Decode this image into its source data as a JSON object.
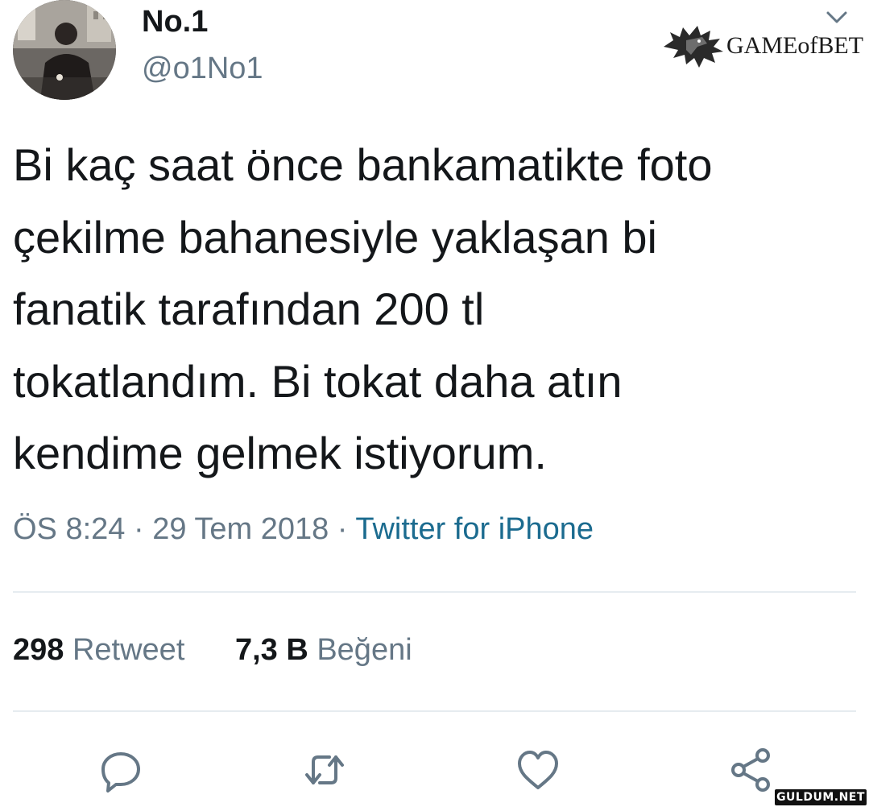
{
  "author": {
    "name": "No.1",
    "handle": "@o1No1"
  },
  "watermark": {
    "brand_text": "GAMEofBET"
  },
  "tweet": {
    "lines": [
      "Bi kaç saat önce bankamatikte foto",
      "çekilme bahanesiyle yaklaşan bi",
      "fanatik tarafından 200 tl",
      "tokatlandım. Bi tokat daha atın",
      "kendime gelmek istiyorum."
    ]
  },
  "meta": {
    "time": "ÖS 8:24",
    "separator": " · ",
    "date": "29 Tem 2018",
    "source": "Twitter for iPhone"
  },
  "stats": {
    "retweet_count": "298",
    "retweet_label": "Retweet",
    "like_count": "7,3 B",
    "like_label": "Beğeni"
  },
  "actions": [
    "reply-icon",
    "retweet-icon",
    "like-icon",
    "share-icon"
  ],
  "site_watermark": "GULDUM.NET",
  "colors": {
    "text": "#14171a",
    "muted": "#657786",
    "source_link": "#1b6b8f",
    "divider": "#e6ecf0"
  }
}
